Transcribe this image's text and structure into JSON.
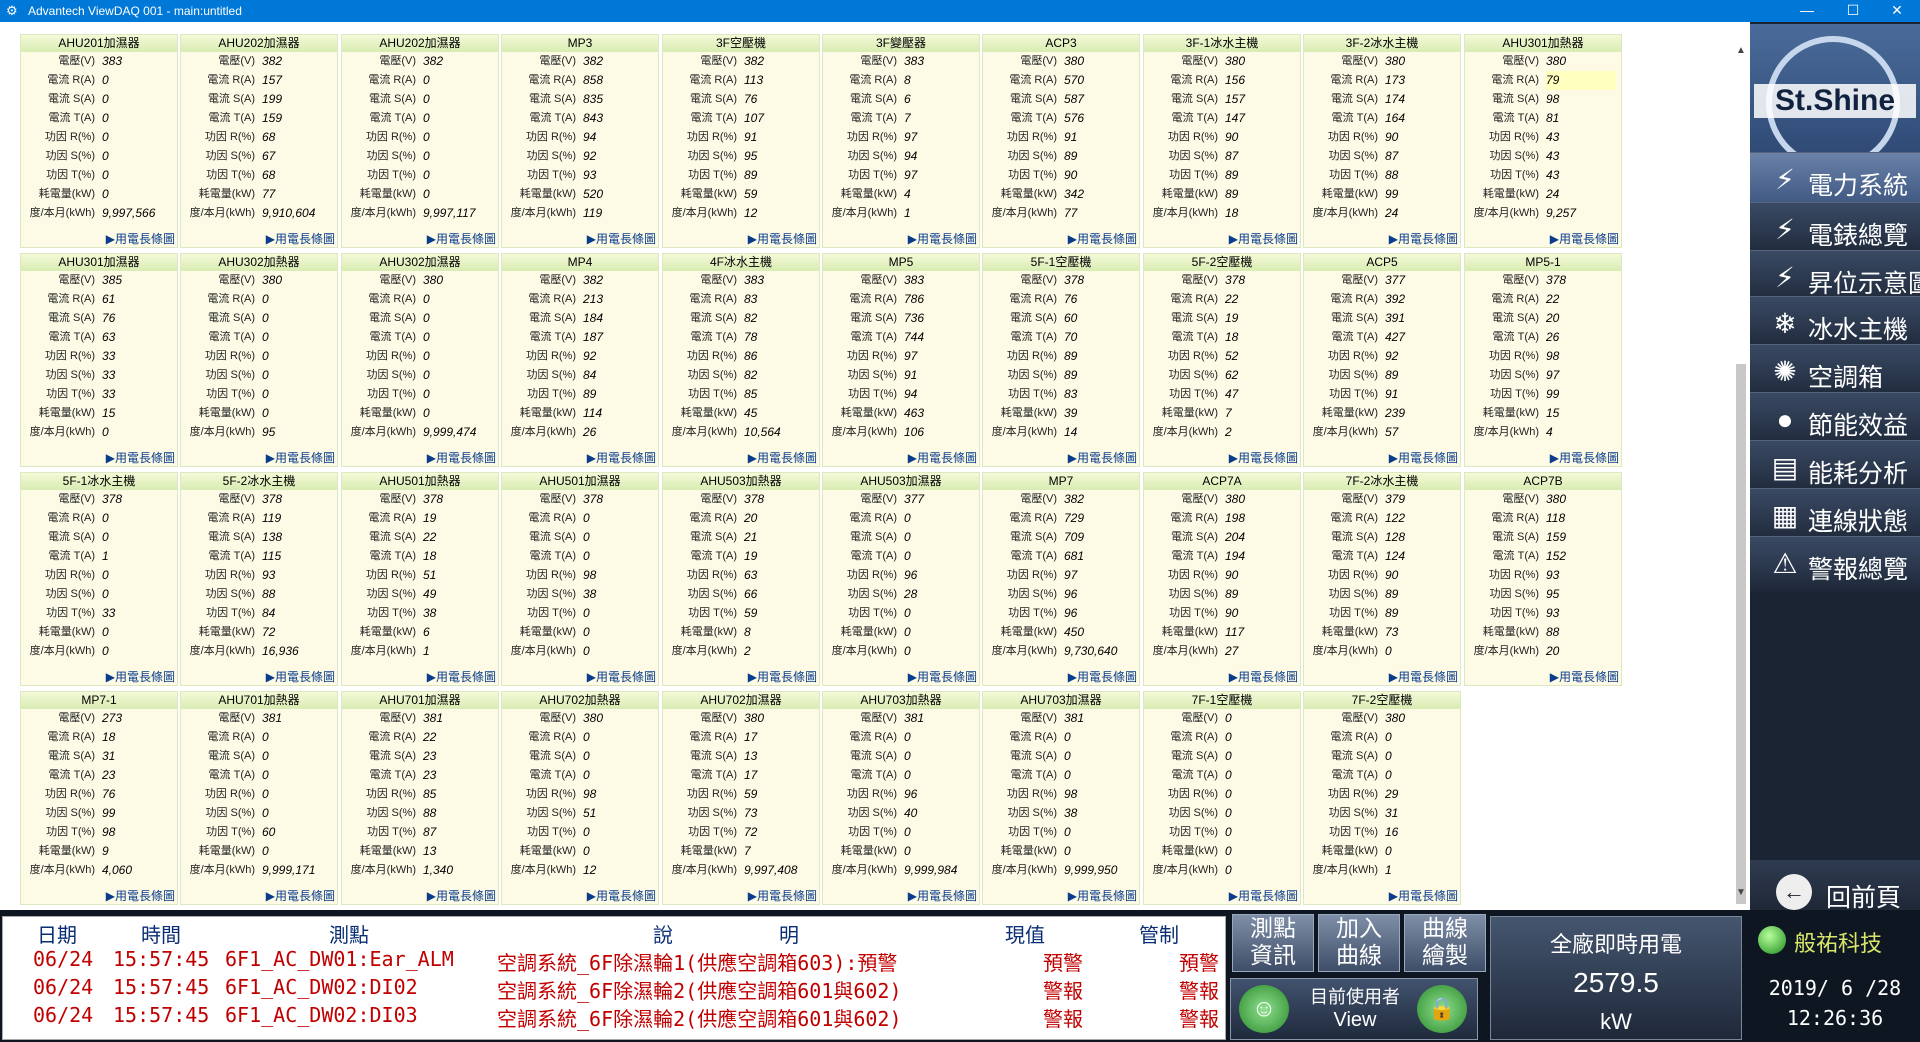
{
  "window": {
    "title": "Advantech ViewDAQ 001 - main:untitled",
    "minimize": "—",
    "maximize": "☐",
    "close": "✕"
  },
  "panel_labels": [
    "電壓(V)",
    "電流 R(A)",
    "電流 S(A)",
    "電流 T(A)",
    "功因 R(%)",
    "功因 S(%)",
    "功因 T(%)",
    "耗電量(kW)",
    "度/本月(kWh)"
  ],
  "panel_link_label": "▶用電長條圖",
  "panels": [
    {
      "name": "AHU201加濕器",
      "values": [
        "383",
        "0",
        "0",
        "0",
        "0",
        "0",
        "0",
        "0",
        "9,997,566"
      ]
    },
    {
      "name": "AHU202加濕器",
      "values": [
        "382",
        "157",
        "199",
        "159",
        "68",
        "67",
        "68",
        "77",
        "9,910,604"
      ]
    },
    {
      "name": "AHU202加濕器",
      "values": [
        "382",
        "0",
        "0",
        "0",
        "0",
        "0",
        "0",
        "0",
        "9,997,117"
      ]
    },
    {
      "name": "MP3",
      "values": [
        "382",
        "858",
        "835",
        "843",
        "94",
        "92",
        "93",
        "520",
        "119"
      ]
    },
    {
      "name": "3F空壓機",
      "values": [
        "382",
        "113",
        "76",
        "107",
        "91",
        "95",
        "89",
        "59",
        "12"
      ]
    },
    {
      "name": "3F變壓器",
      "values": [
        "383",
        "8",
        "6",
        "7",
        "97",
        "94",
        "97",
        "4",
        "1"
      ]
    },
    {
      "name": "ACP3",
      "values": [
        "380",
        "570",
        "587",
        "576",
        "91",
        "89",
        "90",
        "342",
        "77"
      ]
    },
    {
      "name": "3F-1冰水主機",
      "values": [
        "380",
        "156",
        "157",
        "147",
        "90",
        "87",
        "89",
        "89",
        "18"
      ]
    },
    {
      "name": "3F-2冰水主機",
      "values": [
        "380",
        "173",
        "174",
        "164",
        "90",
        "87",
        "88",
        "99",
        "24"
      ]
    },
    {
      "name": "AHU301加熱器",
      "values": [
        "380",
        "79",
        "98",
        "81",
        "43",
        "43",
        "43",
        "24",
        "9,257"
      ],
      "highlight_row": 1
    },
    {
      "name": "AHU301加濕器",
      "values": [
        "385",
        "61",
        "76",
        "63",
        "33",
        "33",
        "33",
        "15",
        "0"
      ]
    },
    {
      "name": "AHU302加熱器",
      "values": [
        "380",
        "0",
        "0",
        "0",
        "0",
        "0",
        "0",
        "0",
        "95"
      ]
    },
    {
      "name": "AHU302加濕器",
      "values": [
        "380",
        "0",
        "0",
        "0",
        "0",
        "0",
        "0",
        "0",
        "9,999,474"
      ]
    },
    {
      "name": "MP4",
      "values": [
        "382",
        "213",
        "184",
        "187",
        "92",
        "84",
        "89",
        "114",
        "26"
      ]
    },
    {
      "name": "4F冰水主機",
      "values": [
        "383",
        "83",
        "82",
        "78",
        "86",
        "82",
        "85",
        "45",
        "10,564"
      ]
    },
    {
      "name": "MP5",
      "values": [
        "383",
        "786",
        "736",
        "744",
        "97",
        "91",
        "94",
        "463",
        "106"
      ]
    },
    {
      "name": "5F-1空壓機",
      "values": [
        "378",
        "76",
        "60",
        "70",
        "89",
        "89",
        "83",
        "39",
        "14"
      ]
    },
    {
      "name": "5F-2空壓機",
      "values": [
        "378",
        "22",
        "19",
        "18",
        "52",
        "62",
        "47",
        "7",
        "2"
      ]
    },
    {
      "name": "ACP5",
      "values": [
        "377",
        "392",
        "391",
        "427",
        "92",
        "89",
        "91",
        "239",
        "57"
      ]
    },
    {
      "name": "MP5-1",
      "values": [
        "378",
        "22",
        "20",
        "26",
        "98",
        "97",
        "99",
        "15",
        "4"
      ]
    },
    {
      "name": "5F-1冰水主機",
      "values": [
        "378",
        "0",
        "0",
        "1",
        "0",
        "0",
        "33",
        "0",
        "0"
      ]
    },
    {
      "name": "5F-2冰水主機",
      "values": [
        "378",
        "119",
        "138",
        "115",
        "93",
        "88",
        "84",
        "72",
        "16,936"
      ]
    },
    {
      "name": "AHU501加熱器",
      "values": [
        "378",
        "19",
        "22",
        "18",
        "51",
        "49",
        "38",
        "6",
        "1"
      ]
    },
    {
      "name": "AHU501加濕器",
      "values": [
        "378",
        "0",
        "0",
        "0",
        "98",
        "38",
        "0",
        "0",
        "0"
      ]
    },
    {
      "name": "AHU503加熱器",
      "values": [
        "378",
        "20",
        "21",
        "19",
        "63",
        "66",
        "59",
        "8",
        "2"
      ]
    },
    {
      "name": "AHU503加濕器",
      "values": [
        "377",
        "0",
        "0",
        "0",
        "96",
        "28",
        "0",
        "0",
        "0"
      ]
    },
    {
      "name": "MP7",
      "values": [
        "382",
        "729",
        "709",
        "681",
        "97",
        "96",
        "96",
        "450",
        "9,730,640"
      ]
    },
    {
      "name": "ACP7A",
      "values": [
        "380",
        "198",
        "204",
        "194",
        "90",
        "89",
        "90",
        "117",
        "27"
      ]
    },
    {
      "name": "7F-2冰水主機",
      "values": [
        "379",
        "122",
        "128",
        "124",
        "90",
        "89",
        "89",
        "73",
        "0"
      ]
    },
    {
      "name": "ACP7B",
      "values": [
        "380",
        "118",
        "159",
        "152",
        "93",
        "95",
        "93",
        "88",
        "20"
      ]
    },
    {
      "name": "MP7-1",
      "values": [
        "273",
        "18",
        "31",
        "23",
        "76",
        "99",
        "98",
        "9",
        "4,060"
      ]
    },
    {
      "name": "AHU701加熱器",
      "values": [
        "381",
        "0",
        "0",
        "0",
        "0",
        "0",
        "60",
        "0",
        "9,999,171"
      ]
    },
    {
      "name": "AHU701加濕器",
      "values": [
        "381",
        "22",
        "23",
        "23",
        "85",
        "88",
        "87",
        "13",
        "1,340"
      ]
    },
    {
      "name": "AHU702加熱器",
      "values": [
        "380",
        "0",
        "0",
        "0",
        "98",
        "51",
        "0",
        "0",
        "12"
      ]
    },
    {
      "name": "AHU702加濕器",
      "values": [
        "380",
        "17",
        "13",
        "17",
        "59",
        "73",
        "72",
        "7",
        "9,997,408"
      ]
    },
    {
      "name": "AHU703加熱器",
      "values": [
        "381",
        "0",
        "0",
        "0",
        "96",
        "40",
        "0",
        "0",
        "9,999,984"
      ]
    },
    {
      "name": "AHU703加濕器",
      "values": [
        "381",
        "0",
        "0",
        "0",
        "98",
        "38",
        "0",
        "0",
        "9,999,950"
      ]
    },
    {
      "name": "7F-1空壓機",
      "values": [
        "0",
        "0",
        "0",
        "0",
        "0",
        "0",
        "0",
        "0",
        "0"
      ]
    },
    {
      "name": "7F-2空壓機",
      "values": [
        "380",
        "0",
        "0",
        "0",
        "29",
        "31",
        "16",
        "0",
        "1"
      ]
    }
  ],
  "sidebar": {
    "logo_text": "St.Shine",
    "items": [
      {
        "label": "電力系統",
        "icon": "⚡"
      },
      {
        "label": "電錶總覽",
        "icon": "⚡"
      },
      {
        "label": "昇位示意圖",
        "icon": "⚡"
      },
      {
        "label": "冰水主機",
        "icon": "❄"
      },
      {
        "label": "空調箱",
        "icon": "✺"
      },
      {
        "label": "節能效益",
        "icon": "●"
      },
      {
        "label": "能耗分析",
        "icon": "▤"
      },
      {
        "label": "連線狀態",
        "icon": "▦"
      },
      {
        "label": "警報總覽",
        "icon": "⚠"
      }
    ],
    "back_label": "回前頁",
    "back_icon": "←"
  },
  "alarm_table": {
    "headers": [
      "日期",
      "時間",
      "測點",
      "說",
      "明",
      "現值",
      "管制"
    ],
    "rows": [
      [
        "06/24",
        "15:57:45",
        "6F1_AC_DW01:Ear_ALM",
        "空調系統_6F除濕輪1(供應空調箱603):預警",
        "預警",
        "預警"
      ],
      [
        "06/24",
        "15:57:45",
        "6F1_AC_DW02:DI02",
        "空調系統_6F除濕輪2(供應空調箱601與602)",
        "警報",
        "警報"
      ],
      [
        "06/24",
        "15:57:45",
        "6F1_AC_DW02:DI03",
        "空調系統_6F除濕輪2(供應空調箱601與602)",
        "警報",
        "警報"
      ]
    ]
  },
  "tool_buttons": {
    "point_info": "測點\n資訊",
    "add_curve": "加入\n曲線",
    "curve_draw": "曲線\n繪製"
  },
  "user": {
    "label": "目前使用者",
    "value": "View"
  },
  "plant_power": {
    "title": "全廠即時用電",
    "value": "2579.5",
    "unit": "kW"
  },
  "company_name": "般祐科技",
  "clock": {
    "date": "2019/ 6 /28",
    "time": "12:26:36"
  },
  "colors": {
    "accent": "#0078d7",
    "alarm_text": "#c00000",
    "header_text": "#0a2e74",
    "panel_bg": "#fdfbe6"
  }
}
